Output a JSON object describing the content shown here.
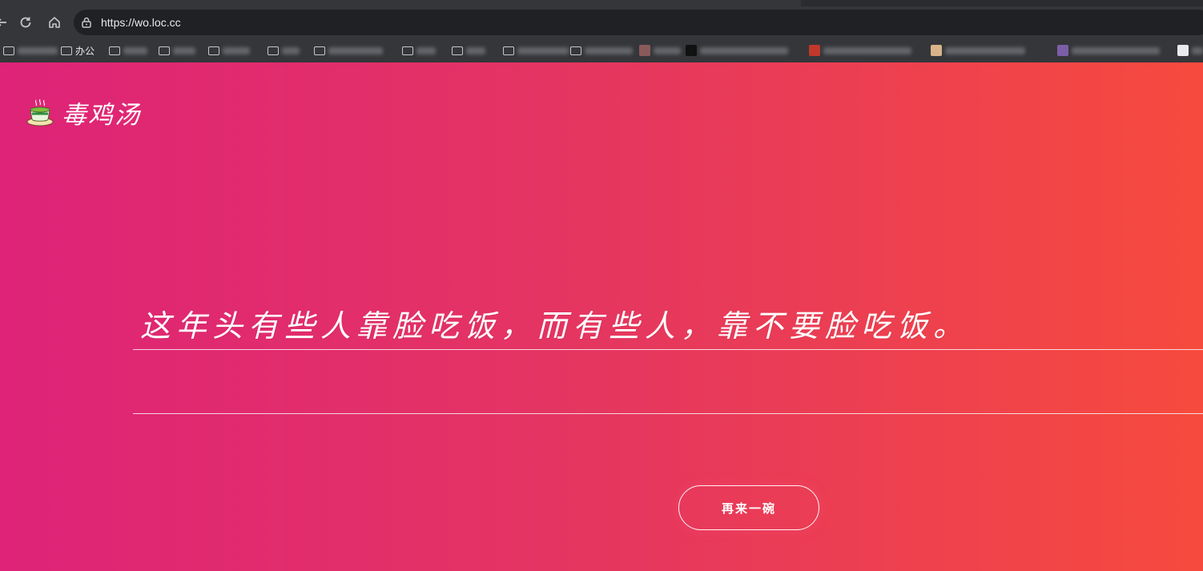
{
  "browser": {
    "url": "https://wo.loc.cc",
    "bookmarks": [
      {
        "type": "folder",
        "label": "",
        "blur_width": 50
      },
      {
        "type": "folder",
        "label": "办公",
        "blur_width": 0
      },
      {
        "type": "folder",
        "label": "",
        "blur_width": 30
      },
      {
        "type": "folder",
        "label": "",
        "blur_width": 28
      },
      {
        "type": "folder",
        "label": "",
        "blur_width": 34
      },
      {
        "type": "folder",
        "label": "",
        "blur_width": 22
      },
      {
        "type": "folder",
        "label": "",
        "blur_width": 68
      },
      {
        "type": "folder",
        "label": "",
        "blur_width": 24
      },
      {
        "type": "folder",
        "label": "",
        "blur_width": 24
      },
      {
        "type": "folder",
        "label": "",
        "blur_width": 64
      },
      {
        "type": "folder",
        "label": "",
        "blur_width": 60
      },
      {
        "type": "site",
        "label": "",
        "blur_width": 34,
        "color": "#8a5a5a"
      },
      {
        "type": "site",
        "label": "",
        "blur_width": 110,
        "color": "#111111"
      },
      {
        "type": "site",
        "label": "",
        "blur_width": 110,
        "color": "#c0392b"
      },
      {
        "type": "site",
        "label": "",
        "blur_width": 100,
        "color": "#d9b48a"
      },
      {
        "type": "site",
        "label": "",
        "blur_width": 110,
        "color": "#7b5ea7"
      },
      {
        "type": "site",
        "label": "",
        "blur_width": 14,
        "color": "#e8eaed"
      }
    ]
  },
  "site": {
    "brand_name": "毒鸡汤",
    "brand_icon": "tea-cup-icon",
    "quote": "这年头有些人靠脸吃饭，而有些人，靠不要脸吃饭。",
    "again_button_label": "再来一碗"
  },
  "colors": {
    "gradient_left": "#de2378",
    "gradient_right": "#f64a3e",
    "text": "#ffffff"
  }
}
